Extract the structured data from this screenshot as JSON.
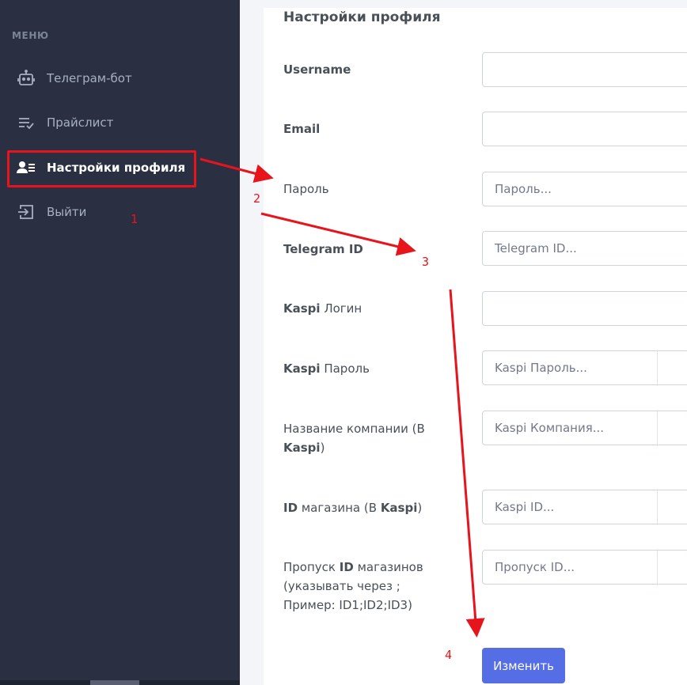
{
  "sidebar": {
    "menu_title": "МЕНЮ",
    "items": [
      {
        "label": "Телеграм-бот",
        "icon": "robot-icon"
      },
      {
        "label": "Прайслист",
        "icon": "list-check-icon"
      },
      {
        "label": "Настройки профиля",
        "icon": "user-list-icon",
        "active": true
      },
      {
        "label": "Выйти",
        "icon": "logout-icon"
      }
    ]
  },
  "profile": {
    "title": "Настройки профиля",
    "fields": {
      "username": {
        "label": "Username",
        "value": "",
        "placeholder": ""
      },
      "email": {
        "label": "Email",
        "value": "",
        "placeholder": ""
      },
      "password": {
        "label": "Пароль",
        "placeholder": "Пароль..."
      },
      "telegram_id": {
        "label": "Telegram ID",
        "placeholder": "Telegram ID..."
      },
      "kaspi_login": {
        "label_strong": "Kaspi",
        "label_rest": " Логин",
        "value": "",
        "placeholder": ""
      },
      "kaspi_password": {
        "label_strong": "Kaspi",
        "label_rest": " Пароль",
        "placeholder": "Kaspi Пароль..."
      },
      "company_name": {
        "label_pre": "Название компании (В ",
        "label_strong": "Kaspi",
        "label_post": ")",
        "placeholder": "Kaspi Компания..."
      },
      "store_id": {
        "label_strong1": "ID",
        "label_mid": " магазина (В ",
        "label_strong2": "Kaspi",
        "label_post": ")",
        "placeholder": "Kaspi ID..."
      },
      "skip_ids": {
        "label_pre": "Пропуск ",
        "label_strong": "ID",
        "label_post": " магазинов (указывать через ; Пример: ID1;ID2;ID3)",
        "placeholder": "Пропуск ID..."
      }
    },
    "submit_label": "Изменить"
  },
  "annotations": {
    "color": "#e8141c",
    "numbers": [
      "1",
      "2",
      "3",
      "4"
    ]
  }
}
